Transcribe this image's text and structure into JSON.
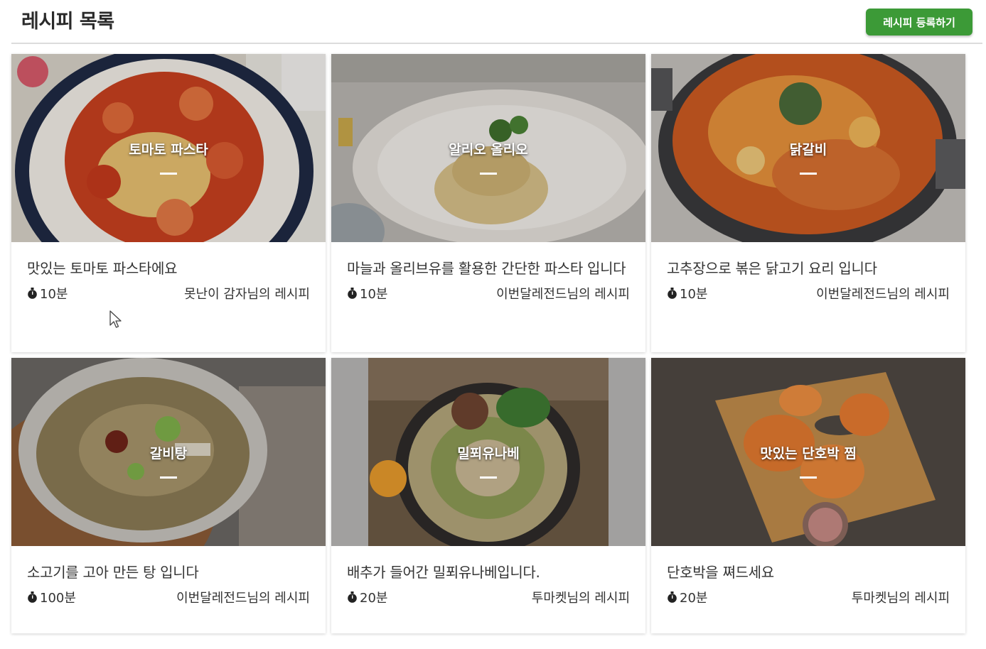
{
  "header": {
    "title": "레시피 목록",
    "register_button": "레시피 등록하기"
  },
  "accent_color": "#3c9a37",
  "recipes": [
    {
      "name": "토마토 파스타",
      "description": "맛있는 토마토 파스타에요",
      "time": "10분",
      "author": "못난이 감자님의 레시피"
    },
    {
      "name": "알리오 올리오",
      "description": "마늘과 올리브유를 활용한 간단한 파스타 입니다",
      "time": "10분",
      "author": "이번달레전드님의 레시피"
    },
    {
      "name": "닭갈비",
      "description": "고추장으로 볶은 닭고기 요리 입니다",
      "time": "10분",
      "author": "이번달레전드님의 레시피"
    },
    {
      "name": "갈비탕",
      "description": "소고기를 고아 만든 탕 입니다",
      "time": "100분",
      "author": "이번달레전드님의 레시피"
    },
    {
      "name": "밀푀유나베",
      "description": "배추가 들어간 밀푀유나베입니다.",
      "time": "20분",
      "author": "투마켓님의 레시피"
    },
    {
      "name": "맛있는 단호박 찜",
      "description": "단호박을 쪄드세요",
      "time": "20분",
      "author": "투마켓님의 레시피"
    }
  ]
}
